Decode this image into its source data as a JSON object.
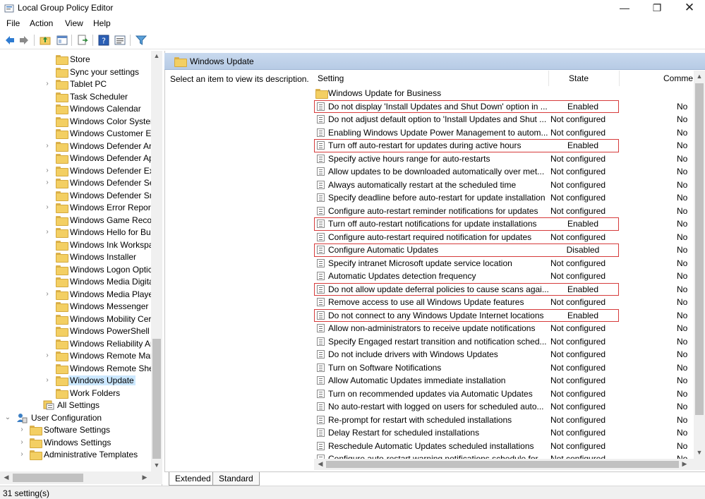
{
  "window": {
    "title": "Local Group Policy Editor",
    "minimize_glyph": "—",
    "maximize_glyph": "❐",
    "close_glyph": "✕"
  },
  "menu": [
    "File",
    "Action",
    "View",
    "Help"
  ],
  "toolbar": {
    "icons": [
      "back-arrow-icon",
      "forward-arrow-icon",
      "up-folder-icon",
      "show-hide-tree-icon",
      "export-list-icon",
      "help-icon",
      "properties-icon",
      "filter-icon"
    ]
  },
  "tree": {
    "items": [
      {
        "label": "Store",
        "expandable": false
      },
      {
        "label": "Sync your settings",
        "expandable": false
      },
      {
        "label": "Tablet PC",
        "expandable": true
      },
      {
        "label": "Task Scheduler",
        "expandable": false
      },
      {
        "label": "Windows Calendar",
        "expandable": false
      },
      {
        "label": "Windows Color Syster",
        "expandable": false
      },
      {
        "label": "Windows Customer Ex",
        "expandable": false
      },
      {
        "label": "Windows Defender Ar",
        "expandable": true
      },
      {
        "label": "Windows Defender Ap",
        "expandable": false
      },
      {
        "label": "Windows Defender Exp",
        "expandable": true
      },
      {
        "label": "Windows Defender Se",
        "expandable": true
      },
      {
        "label": "Windows Defender Sm",
        "expandable": false
      },
      {
        "label": "Windows Error Report",
        "expandable": true
      },
      {
        "label": "Windows Game Recor",
        "expandable": false
      },
      {
        "label": "Windows Hello for Bu",
        "expandable": true
      },
      {
        "label": "Windows Ink Workspa",
        "expandable": false
      },
      {
        "label": "Windows Installer",
        "expandable": false
      },
      {
        "label": "Windows Logon Optic",
        "expandable": false
      },
      {
        "label": "Windows Media Digita",
        "expandable": false
      },
      {
        "label": "Windows Media Playe",
        "expandable": true
      },
      {
        "label": "Windows Messenger",
        "expandable": false
      },
      {
        "label": "Windows Mobility Cer",
        "expandable": false
      },
      {
        "label": "Windows PowerShell",
        "expandable": false
      },
      {
        "label": "Windows Reliability Ar",
        "expandable": false
      },
      {
        "label": "Windows Remote Mar",
        "expandable": true
      },
      {
        "label": "Windows Remote She",
        "expandable": false
      },
      {
        "label": "Windows Update",
        "expandable": true,
        "selected": true
      },
      {
        "label": "Work Folders",
        "expandable": false
      }
    ],
    "all_settings": "All Settings",
    "user_configuration": "User Configuration",
    "user_children": [
      "Software Settings",
      "Windows Settings",
      "Administrative Templates"
    ]
  },
  "right": {
    "header_title": "Windows Update",
    "description": "Select an item to view its description.",
    "columns": {
      "setting": "Setting",
      "state": "State",
      "comment": "Comme"
    },
    "category": "Windows Update for Business",
    "rows": [
      {
        "name": "Do not display 'Install Updates and Shut Down' option in ...",
        "state": "Enabled",
        "highlight": true,
        "comment": "No"
      },
      {
        "name": "Do not adjust default option to 'Install Updates and Shut ...",
        "state": "Not configured",
        "highlight": false,
        "comment": "No"
      },
      {
        "name": "Enabling Windows Update Power Management to autom...",
        "state": "Not configured",
        "highlight": false,
        "comment": "No"
      },
      {
        "name": "Turn off auto-restart for updates during active hours",
        "state": "Enabled",
        "highlight": true,
        "comment": "No"
      },
      {
        "name": "Specify active hours range for auto-restarts",
        "state": "Not configured",
        "highlight": false,
        "comment": "No"
      },
      {
        "name": "Allow updates to be downloaded automatically over met...",
        "state": "Not configured",
        "highlight": false,
        "comment": "No"
      },
      {
        "name": "Always automatically restart at the scheduled time",
        "state": "Not configured",
        "highlight": false,
        "comment": "No"
      },
      {
        "name": "Specify deadline before auto-restart for update installation",
        "state": "Not configured",
        "highlight": false,
        "comment": "No"
      },
      {
        "name": "Configure auto-restart reminder notifications for updates",
        "state": "Not configured",
        "highlight": false,
        "comment": "No"
      },
      {
        "name": "Turn off auto-restart notifications for update installations",
        "state": "Enabled",
        "highlight": true,
        "comment": "No"
      },
      {
        "name": "Configure auto-restart required notification for updates",
        "state": "Not configured",
        "highlight": false,
        "comment": "No"
      },
      {
        "name": "Configure Automatic Updates",
        "state": "Disabled",
        "highlight": true,
        "comment": "No"
      },
      {
        "name": "Specify intranet Microsoft update service location",
        "state": "Not configured",
        "highlight": false,
        "comment": "No"
      },
      {
        "name": "Automatic Updates detection frequency",
        "state": "Not configured",
        "highlight": false,
        "comment": "No"
      },
      {
        "name": "Do not allow update deferral policies to cause scans agai...",
        "state": "Enabled",
        "highlight": true,
        "comment": "No"
      },
      {
        "name": "Remove access to use all Windows Update features",
        "state": "Not configured",
        "highlight": false,
        "comment": "No"
      },
      {
        "name": "Do not connect to any Windows Update Internet locations",
        "state": "Enabled",
        "highlight": true,
        "comment": "No"
      },
      {
        "name": "Allow non-administrators to receive update notifications",
        "state": "Not configured",
        "highlight": false,
        "comment": "No"
      },
      {
        "name": "Specify Engaged restart transition and notification sched...",
        "state": "Not configured",
        "highlight": false,
        "comment": "No"
      },
      {
        "name": "Do not include drivers with Windows Updates",
        "state": "Not configured",
        "highlight": false,
        "comment": "No"
      },
      {
        "name": "Turn on Software Notifications",
        "state": "Not configured",
        "highlight": false,
        "comment": "No"
      },
      {
        "name": "Allow Automatic Updates immediate installation",
        "state": "Not configured",
        "highlight": false,
        "comment": "No"
      },
      {
        "name": "Turn on recommended updates via Automatic Updates",
        "state": "Not configured",
        "highlight": false,
        "comment": "No"
      },
      {
        "name": "No auto-restart with logged on users for scheduled auto...",
        "state": "Not configured",
        "highlight": false,
        "comment": "No"
      },
      {
        "name": "Re-prompt for restart with scheduled installations",
        "state": "Not configured",
        "highlight": false,
        "comment": "No"
      },
      {
        "name": "Delay Restart for scheduled installations",
        "state": "Not configured",
        "highlight": false,
        "comment": "No"
      },
      {
        "name": "Reschedule Automatic Updates scheduled installations",
        "state": "Not configured",
        "highlight": false,
        "comment": "No"
      },
      {
        "name": "Configure auto-restart warning notifications schedule for...",
        "state": "Not configured",
        "highlight": false,
        "comment": "No"
      }
    ]
  },
  "tabs": [
    "Extended",
    "Standard"
  ],
  "status": "31 setting(s)",
  "colors": {
    "highlight_border": "#d63b3b",
    "selection": "#cce8ff",
    "header_bg": "#c8d9ee"
  }
}
